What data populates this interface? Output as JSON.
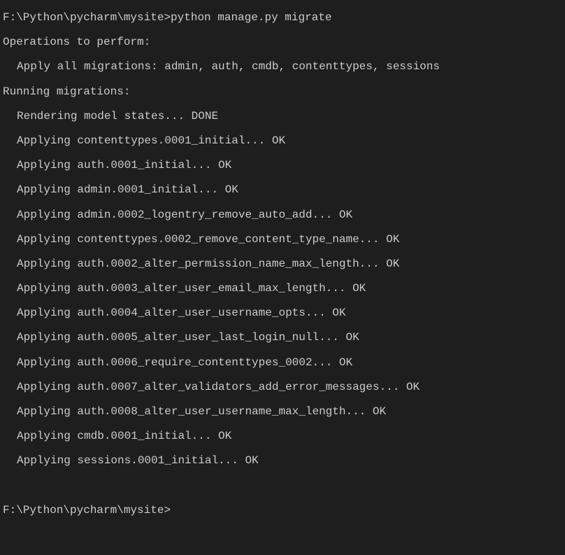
{
  "prompt1": "F:\\Python\\pycharm\\mysite>python manage.py migrate",
  "operations_header": "Operations to perform:",
  "apply_all": "Apply all migrations: admin, auth, cmdb, contenttypes, sessions",
  "running_header": "Running migrations:",
  "rendering": "Rendering model states... DONE",
  "migrations": [
    "Applying contenttypes.0001_initial... OK",
    "Applying auth.0001_initial... OK",
    "Applying admin.0001_initial... OK",
    "Applying admin.0002_logentry_remove_auto_add... OK",
    "Applying contenttypes.0002_remove_content_type_name... OK",
    "Applying auth.0002_alter_permission_name_max_length... OK",
    "Applying auth.0003_alter_user_email_max_length... OK",
    "Applying auth.0004_alter_user_username_opts... OK",
    "Applying auth.0005_alter_user_last_login_null... OK",
    "Applying auth.0006_require_contenttypes_0002... OK",
    "Applying auth.0007_alter_validators_add_error_messages... OK",
    "Applying auth.0008_alter_user_username_max_length... OK",
    "Applying cmdb.0001_initial... OK",
    "Applying sessions.0001_initial... OK"
  ],
  "prompt2": "F:\\Python\\pycharm\\mysite>"
}
